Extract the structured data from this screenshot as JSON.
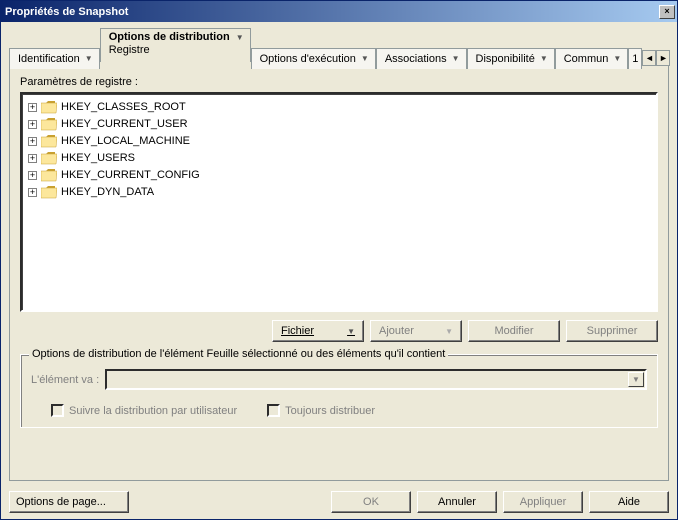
{
  "window": {
    "title": "Propriétés de Snapshot"
  },
  "tabs": {
    "identification": "Identification",
    "distribution": {
      "line1": "Options de distribution",
      "line2": "Registre"
    },
    "execution": "Options d'exécution",
    "associations": "Associations",
    "disponibilite": "Disponibilité",
    "commun": "Commun",
    "truncated": "1"
  },
  "section": {
    "label": "Paramètres de registre :"
  },
  "tree": {
    "items": [
      {
        "label": "HKEY_CLASSES_ROOT"
      },
      {
        "label": "HKEY_CURRENT_USER"
      },
      {
        "label": "HKEY_LOCAL_MACHINE"
      },
      {
        "label": "HKEY_USERS"
      },
      {
        "label": "HKEY_CURRENT_CONFIG"
      },
      {
        "label": "HKEY_DYN_DATA"
      }
    ]
  },
  "buttons": {
    "fichier": "Fichier",
    "ajouter": "Ajouter",
    "modifier": "Modifier",
    "supprimer": "Supprimer"
  },
  "group": {
    "legend": "Options de distribution de l'élément Feuille sélectionné ou des éléments qu'il contient",
    "element_label": "L'élément va :",
    "check1": "Suivre la distribution par utilisateur",
    "check2": "Toujours distribuer"
  },
  "footer": {
    "page_options": "Options de page...",
    "ok": "OK",
    "cancel": "Annuler",
    "apply": "Appliquer",
    "help": "Aide"
  }
}
